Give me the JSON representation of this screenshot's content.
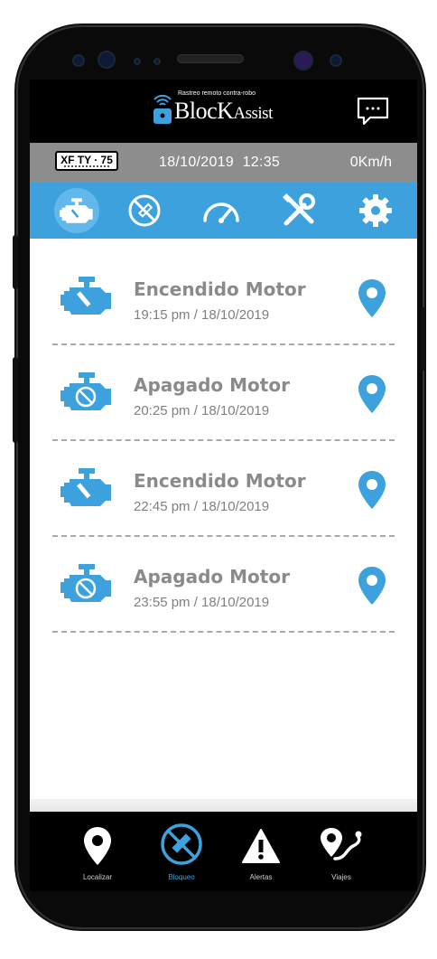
{
  "app": {
    "logo_tagline": "Rastreo remoto contra-robo",
    "logo_name_main": "BlocK",
    "logo_name_suffix": "Assist"
  },
  "status_bar": {
    "plate": "XF TY · 75",
    "datetime": "18/10/2019  12:35",
    "speed": "0Km/h"
  },
  "tabs": [
    {
      "icon": "engine-icon",
      "active": true
    },
    {
      "icon": "block-icon",
      "active": false
    },
    {
      "icon": "speedometer-icon",
      "active": false
    },
    {
      "icon": "tools-icon",
      "active": false
    },
    {
      "icon": "gear-icon",
      "active": false
    }
  ],
  "events": [
    {
      "title": "Encendido Motor",
      "time": "19:15 pm / 18/10/2019",
      "icon": "engine-on-icon"
    },
    {
      "title": "Apagado Motor",
      "time": "20:25 pm / 18/10/2019",
      "icon": "engine-off-icon"
    },
    {
      "title": "Encendido Motor",
      "time": "22:45 pm / 18/10/2019",
      "icon": "engine-on-icon"
    },
    {
      "title": "Apagado Motor",
      "time": "23:55 pm / 18/10/2019",
      "icon": "engine-off-icon"
    }
  ],
  "bottom_nav": [
    {
      "label": "Localizar",
      "icon": "location-pin-icon",
      "active": false
    },
    {
      "label": "Bloqueo",
      "icon": "block-icon",
      "active": true
    },
    {
      "label": "Alertas",
      "icon": "warning-icon",
      "active": false
    },
    {
      "label": "Viajes",
      "icon": "route-icon",
      "active": false
    }
  ],
  "colors": {
    "accent": "#3da1dd",
    "status_bar": "#8d8d8d",
    "text_gray": "#8a8a8a"
  }
}
